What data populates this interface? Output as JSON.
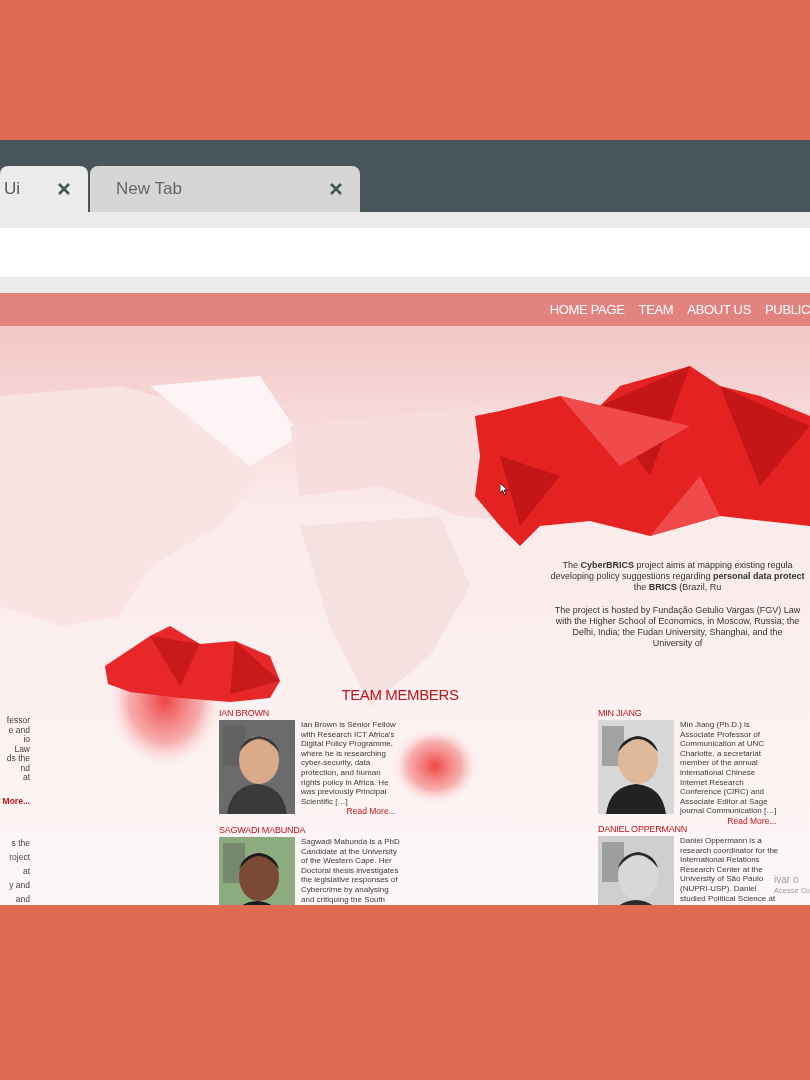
{
  "browser": {
    "tabs": [
      {
        "label": "Ui",
        "selected": true
      },
      {
        "label": "New Tab",
        "selected": false
      }
    ]
  },
  "nav": {
    "links": [
      "HOME PAGE",
      "TEAM",
      "ABOUT US",
      "PUBLIC"
    ]
  },
  "intro": {
    "paragraphs": [
      [
        "The **CyberBRICS** project aims at mapping existing regula",
        "developing policy suggestions regarding **personal data protect**",
        "the **BRICS** (Brazil, Ru"
      ],
      [
        "The project is hosted by Fundação Getulio Vargas (FGV) Law",
        "with the Higher School of Economics, in Moscow, Russia; the",
        "Delhi, India; the Fudan University, Shanghai, and the",
        "University of"
      ]
    ]
  },
  "left_column": {
    "upper_lines": [
      "fessor",
      "e and",
      "io",
      "Law",
      "ds the",
      "nd",
      "at"
    ],
    "read_more": "More...",
    "lower_lines": [
      "s the",
      "roject",
      "at",
      "y and",
      "and"
    ]
  },
  "team": {
    "title": "TEAM MEMBERS",
    "members": [
      {
        "name": "IAN BROWN",
        "bio_lines": [
          "Ian Brown is Senior Fellow",
          "with Research ICT Africa's",
          "Digital Policy Programme,",
          "where he is researching",
          "cyber-security, data",
          "protection, and human",
          "rights policy in Africa. He",
          "was previously Principal",
          "Scientific […]"
        ],
        "read_more": "Read More..."
      },
      {
        "name": "MIN JIANG",
        "bio_lines": [
          "Min Jiang (Ph.D.) is",
          "Associate Professor of",
          "Communication at UNC",
          "Charlotte, a secretariat",
          "member of the annual",
          "international Chinese",
          "Internet Research",
          "Conference (CIRC) and",
          "Associate Editor at Sage",
          "journal Communication […]"
        ],
        "read_more": "Read More..."
      },
      {
        "name": "SAGWADI MABUNDA",
        "bio_lines": [
          "Sagwadi Mabunda is a PhD",
          "Candidate at the University",
          "of the Western Cape. Her",
          "Doctoral thesis investigates",
          "the legislative responses of",
          "Cybercrime by analysing",
          "and critiquing the South"
        ]
      },
      {
        "name": "DANIEL OPPERMANN",
        "bio_lines": [
          "Daniel Oppermann is a",
          "research coordinator for the",
          "International Relations",
          "Research Center at the",
          "University of São Paulo",
          "(NUPRI-USP). Daniel",
          "studied Political Science at"
        ]
      }
    ]
  },
  "activation_notice": [
    "ivar o",
    "Acesse Co"
  ]
}
